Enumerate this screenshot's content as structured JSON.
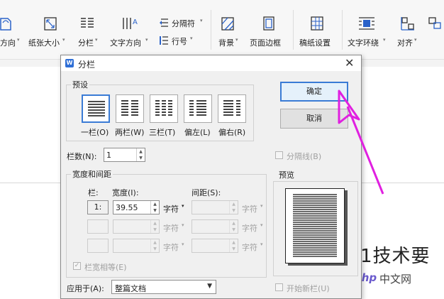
{
  "ribbon": {
    "items": [
      {
        "label": "方向",
        "icon": "page-orientation-icon",
        "dropdown": true
      },
      {
        "label": "纸张大小",
        "icon": "paper-size-icon",
        "dropdown": true
      },
      {
        "label": "分栏",
        "icon": "columns-icon",
        "dropdown": true
      },
      {
        "label": "文字方向",
        "icon": "text-direction-icon",
        "dropdown": true
      },
      {
        "label": "分隔符",
        "icon": "separator-icon",
        "dropdown": true
      },
      {
        "label": "行号",
        "icon": "line-number-icon",
        "dropdown": true
      },
      {
        "label": "背景",
        "icon": "background-icon",
        "dropdown": true
      },
      {
        "label": "页面边框",
        "icon": "page-border-icon",
        "dropdown": false
      },
      {
        "label": "稿纸设置",
        "icon": "manuscript-paper-icon",
        "dropdown": false
      },
      {
        "label": "文字环绕",
        "icon": "text-wrap-icon",
        "dropdown": true
      },
      {
        "label": "对齐",
        "icon": "align-icon",
        "dropdown": true
      }
    ]
  },
  "document": {
    "visible_text": "1技术要"
  },
  "watermark": {
    "logo": "php",
    "text": "中文网"
  },
  "dialog": {
    "title": "分栏",
    "presets_label": "预设",
    "presets": [
      {
        "label": "一栏(O)",
        "selected": true
      },
      {
        "label": "两栏(W)",
        "selected": false
      },
      {
        "label": "三栏(T)",
        "selected": false
      },
      {
        "label": "偏左(L)",
        "selected": false
      },
      {
        "label": "偏右(R)",
        "selected": false
      }
    ],
    "ok_label": "确定",
    "cancel_label": "取消",
    "columns_label": "栏数(N):",
    "columns_value": "1",
    "separator_label": "分隔线(B)",
    "width_spacing_label": "宽度和间距",
    "col_header": "栏:",
    "width_header": "宽度(I):",
    "spacing_header": "间距(S):",
    "rows": [
      {
        "col": "1:",
        "width": "39.55",
        "width_unit": "字符",
        "spacing": "",
        "spacing_unit": "字符"
      },
      {
        "col": "",
        "width": "",
        "width_unit": "字符",
        "spacing": "",
        "spacing_unit": "字符"
      },
      {
        "col": "",
        "width": "",
        "width_unit": "字符",
        "spacing": "",
        "spacing_unit": "字符"
      }
    ],
    "equal_width_label": "栏宽相等(E)",
    "preview_label": "预览",
    "apply_to_label": "应用于(A):",
    "apply_to_value": "整篇文档",
    "start_new_column_label": "开始新栏(U)"
  },
  "colors": {
    "accent": "#3a7bd5",
    "arrow": "#e020e0"
  }
}
